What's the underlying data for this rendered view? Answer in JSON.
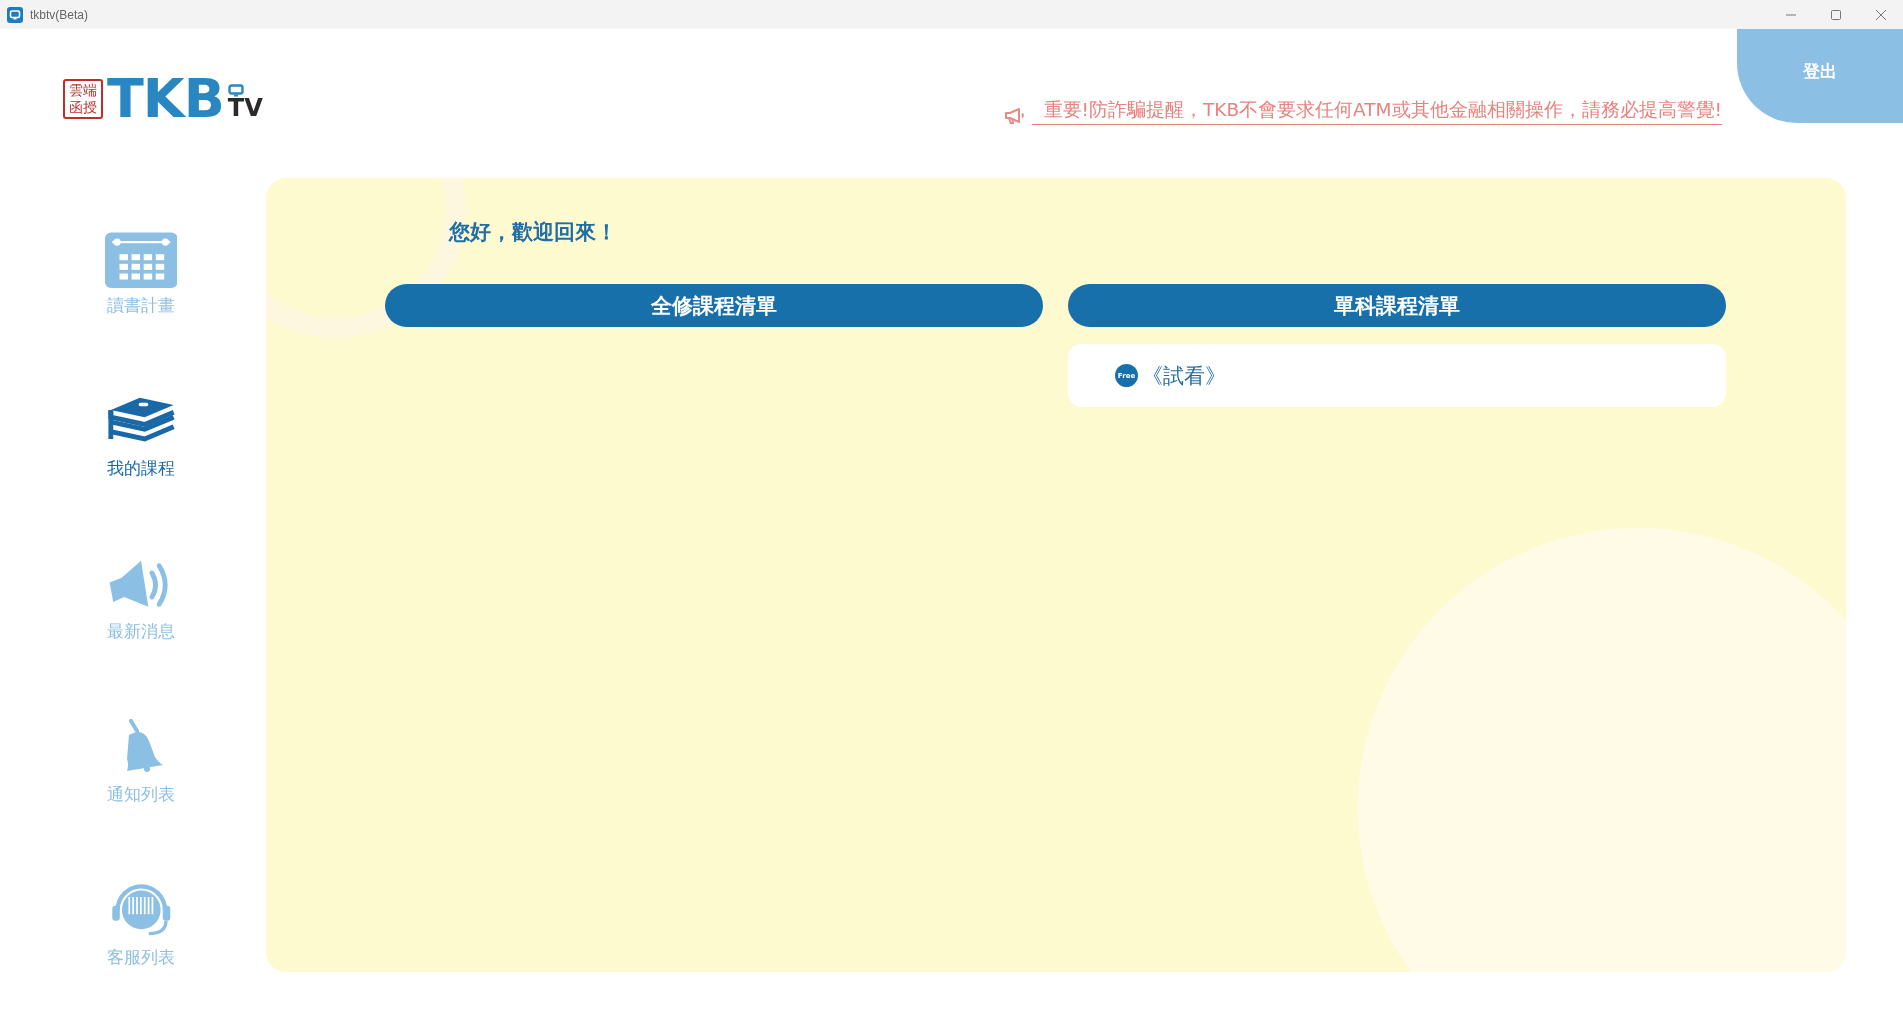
{
  "window": {
    "title": "tkbtv(Beta)"
  },
  "logo": {
    "seal": [
      "雲端",
      "函授"
    ],
    "brand": "TKB",
    "suffix": "TV"
  },
  "notice": "重要!防詐騙提醒，TKB不會要求任何ATM或其他金融相關操作，請務必提高警覺!",
  "logout": "登出",
  "sidebar": {
    "items": [
      {
        "label": "讀書計畫",
        "kind": "calendar",
        "selected": false
      },
      {
        "label": "我的課程",
        "kind": "books",
        "selected": true
      },
      {
        "label": "最新消息",
        "kind": "speaker",
        "selected": false
      },
      {
        "label": "通知列表",
        "kind": "bell",
        "selected": false
      },
      {
        "label": "客服列表",
        "kind": "headset",
        "selected": false
      }
    ]
  },
  "greeting": "您好，歡迎回來！",
  "columns": [
    {
      "title": "全修課程清單"
    },
    {
      "title": "單科課程清單",
      "items": [
        {
          "badge": "Free",
          "label": "《試看》"
        }
      ]
    }
  ]
}
